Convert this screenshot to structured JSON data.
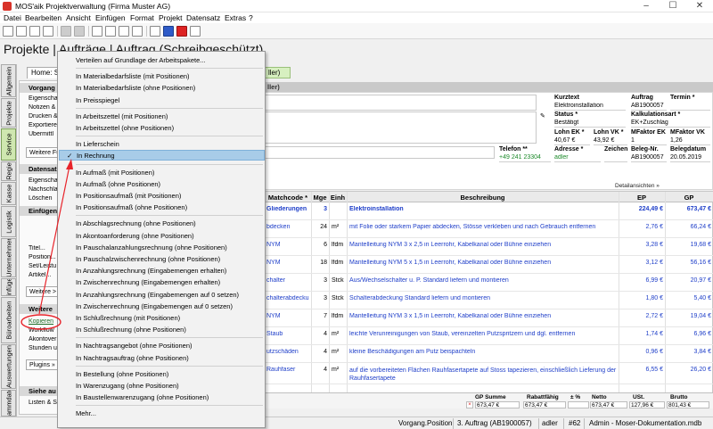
{
  "window": {
    "title": "MOS'aik Projektverwaltung (Firma Muster AG)"
  },
  "menubar": [
    "Datei",
    "Bearbeiten",
    "Ansicht",
    "Einfügen",
    "Format",
    "Projekt",
    "Datensatz",
    "Extras",
    "?"
  ],
  "page_title": "Projekte | Aufträge | Auftrag (Schreibgeschützt)",
  "breadcrumb": {
    "home": "Home: S",
    "partial": "ller)"
  },
  "vtabs": [
    "Allgemein",
    "Projekte",
    "Service",
    "Regie",
    "Kasse",
    "Logistik",
    "Unternehmer",
    "Einfügen",
    "Büroarbeiten",
    "Auswertungen",
    "Stammdaten"
  ],
  "sidepanel": {
    "sections": [
      {
        "title": "Vorgang",
        "items": [
          "Eigenscha",
          "Notizen &",
          "Drucken &",
          "Exportiere",
          "Übermittl"
        ],
        "button": "Weitere Fu"
      },
      {
        "title": "Datensatz",
        "items": [
          "Eigenschaf",
          "Nachschlag",
          "Löschen"
        ]
      },
      {
        "title": "Einfügen",
        "items": [
          "Titel...",
          "Position...",
          "Set/Leistu",
          "Artikel..."
        ],
        "button": "Weitere >"
      },
      {
        "title": "Weitere",
        "items": [
          "Kopieren",
          "Workflow",
          "Akontover",
          "Stunden u"
        ],
        "button": "Plugins »"
      },
      {
        "title": "Siehe au",
        "items": [
          "Listen & St"
        ]
      }
    ]
  },
  "form": {
    "panel_header": "ller)",
    "kurztext_label": "Kurztext",
    "kurztext": "Elektroinstallation",
    "auftrag_label": "Auftrag",
    "auftrag": "AB1900057",
    "termin_label": "Termin *",
    "status_label": "Status *",
    "status": "Bestätigt",
    "kalkulationsart_label": "Kalkulationsart *",
    "kalkulationsart": "EK+Zuschlag",
    "lohn_ek_label": "Lohn EK *",
    "lohn_ek": "40,67 €",
    "lohn_vk_label": "Lohn VK *",
    "lohn_vk": "43,92 €",
    "mfaktor_ek_label": "MFaktor EK",
    "mfaktor_ek": "1",
    "mfaktor_vk_label": "MFaktor VK",
    "mfaktor_vk": "1,26",
    "telefon_label": "Telefon **",
    "telefon": "+49 241 23304",
    "adresse_label": "Adresse *",
    "adresse": "adler",
    "zeichen_label": "Zeichen",
    "belegnr_label": "Beleg-Nr.",
    "belegnr": "AB1900057",
    "belegdatum_label": "Belegdatum",
    "belegdatum": "20.05.2019"
  },
  "detail_link": "Detailansichten »",
  "grid": {
    "headers": [
      "Matchcode *",
      "Mge",
      "Einh",
      "Beschreibung",
      "EP",
      "GP"
    ],
    "rows": [
      {
        "match": "Gliederungen",
        "mge": "3",
        "einh": "",
        "desc": "Elektroinstallation",
        "ep": "224,49 €",
        "gp": "673,47 €",
        "group": true
      },
      {
        "match": "bdecken",
        "mge": "24",
        "einh": "m²",
        "desc": "mit Folie oder starkem Papier abdecken, Stösse verkleben und nach Gebrauch entfernen",
        "ep": "2,76 €",
        "gp": "66,24 €"
      },
      {
        "match": "NYM",
        "mge": "6",
        "einh": "lfdm",
        "desc": "Mantelleitung NYM 3 x 2,5 in Leerrohr, Kabelkanal oder Bühne einziehen",
        "ep": "3,28 €",
        "gp": "19,68 €"
      },
      {
        "match": "NYM",
        "mge": "18",
        "einh": "lfdm",
        "desc": "Mantelleitung NYM 5 x 1,5 in Leerrohr, Kabelkanal oder Bühne einziehen",
        "ep": "3,12 €",
        "gp": "56,16 €"
      },
      {
        "match": "chalter",
        "mge": "3",
        "einh": "Stck",
        "desc": "Aus/Wechselschalter u. P. Standard liefern und montieren",
        "ep": "6,99 €",
        "gp": "20,97 €"
      },
      {
        "match": "chalterabdeckung",
        "mge": "3",
        "einh": "Stck",
        "desc": "Schalterabdeckung Standard liefern und montieren",
        "ep": "1,80 €",
        "gp": "5,40 €"
      },
      {
        "match": "NYM",
        "mge": "7",
        "einh": "lfdm",
        "desc": "Mantelleitung NYM 3 x 1,5 in Leerrohr, Kabelkanal oder Bühne einziehen",
        "ep": "2,72 €",
        "gp": "19,04 €"
      },
      {
        "match": "Staub",
        "mge": "4",
        "einh": "m²",
        "desc": "leichte Verunreinigungen von Staub, vereinzelten Putzspritzern und dgl. entfernen",
        "ep": "1,74 €",
        "gp": "6,96 €"
      },
      {
        "match": "utzschäden",
        "mge": "4",
        "einh": "m²",
        "desc": "kleine Beschädigungen am Putz beispachteln",
        "ep": "0,96 €",
        "gp": "3,84 €"
      },
      {
        "match": "Rauhfaser",
        "mge": "4",
        "einh": "m²",
        "desc": "auf die vorbereiteten Flächen Rauhfasertapete auf Stoss tapezieren, einschließlich Lieferung der Rauhfasertapete",
        "ep": "6,55 €",
        "gp": "26,20 €"
      }
    ]
  },
  "totals": {
    "gp_summe_label": "GP Summe",
    "gp_summe": "673,47 €",
    "rabattfaehig_label": "Rabattfähig",
    "rabattfaehig": "673,47 €",
    "prozent_label": "± %",
    "netto_label": "Netto",
    "netto": "673,47 €",
    "ust_label": "USt.",
    "ust": "127,96 €",
    "brutto_label": "Brutto",
    "brutto": "801,43 €"
  },
  "statusbar": {
    "s1": "Vorgang.Position",
    "s2": "3. Auftrag (AB1900057)",
    "s3": "adler",
    "s4": "#62",
    "s5": "Admin - Moser-Dokumentation.mdb"
  },
  "context_menu": {
    "items": [
      {
        "label": "Verteilen auf Grundlage der Arbeitspakete...",
        "sep_after": true
      },
      {
        "label": "In Materialbedarfsliste (mit Positionen)"
      },
      {
        "label": "In Materialbedarfsliste (ohne Positionen)"
      },
      {
        "label": "In Preisspiegel",
        "sep_after": true
      },
      {
        "label": "In Arbeitszettel (mit Positionen)"
      },
      {
        "label": "In Arbeitszettel (ohne Positionen)",
        "sep_after": true
      },
      {
        "label": "In Lieferschein"
      },
      {
        "label": "In Rechnung",
        "highlighted": true,
        "checked": true,
        "sep_after": true
      },
      {
        "label": "In Aufmaß (mit Positionen)"
      },
      {
        "label": "In Aufmaß (ohne Positionen)"
      },
      {
        "label": "In Positionsaufmaß (mit Positionen)"
      },
      {
        "label": "In Positionsaufmaß (ohne Positionen)",
        "sep_after": true
      },
      {
        "label": "In Abschlagsrechnung (ohne Positionen)"
      },
      {
        "label": "In Akontoanforderung (ohne Positionen)"
      },
      {
        "label": "In Pauschalanzahlungsrechnung (ohne Positionen)"
      },
      {
        "label": "In Pauschalzwischenrechnung (ohne Positionen)"
      },
      {
        "label": "In Anzahlungsrechnung (Eingabemengen erhalten)"
      },
      {
        "label": "In Zwischenrechnung (Eingabemengen erhalten)"
      },
      {
        "label": "In Anzahlungsrechnung (Eingabemengen auf 0 setzen)"
      },
      {
        "label": "In Zwischenrechnung (Eingabemengen auf 0 setzen)"
      },
      {
        "label": "In Schlußrechnung (mit Positionen)"
      },
      {
        "label": "In Schlußrechnung (ohne Positionen)",
        "sep_after": true
      },
      {
        "label": "In Nachtragsangebot (ohne Positionen)"
      },
      {
        "label": "In Nachtragsauftrag (ohne Positionen)",
        "sep_after": true
      },
      {
        "label": "In Bestellung (ohne Positionen)"
      },
      {
        "label": "In Warenzugang (ohne Positionen)"
      },
      {
        "label": "In Baustellenwarenzugang (ohne Positionen)",
        "sep_after": true
      },
      {
        "label": "Mehr..."
      }
    ]
  },
  "colors": {
    "highlight": "#a8cce8",
    "link_green": "#1f6e2a",
    "value_blue": "#1f3fc9",
    "annotation_red": "#e8232a"
  }
}
